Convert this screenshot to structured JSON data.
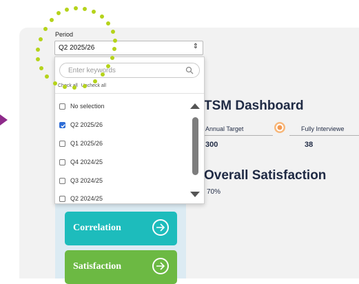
{
  "filter": {
    "label": "Period",
    "selected": "Q2 2025/26",
    "search_placeholder": "Enter keywords",
    "check_all": "Check all",
    "uncheck_all": "Uncheck all",
    "options": [
      {
        "label": "No selection",
        "checked": false
      },
      {
        "label": "Q2 2025/26",
        "checked": true
      },
      {
        "label": "Q1 2025/26",
        "checked": false
      },
      {
        "label": "Q4 2024/25",
        "checked": false
      },
      {
        "label": "Q3 2024/25",
        "checked": false
      },
      {
        "label": "Q2 2024/25",
        "checked": false
      }
    ]
  },
  "dashboard": {
    "title": "TSM Dashboard",
    "kpis": [
      {
        "label": "Annual Target",
        "value": "300"
      },
      {
        "label": "Fully Interviewe",
        "value": "38"
      }
    ],
    "section_title": "Overall Satisfaction",
    "satisfaction_value": "70%"
  },
  "nav": {
    "correlation": "Correlation",
    "satisfaction": "Satisfaction"
  },
  "colors": {
    "correlation": "#1dbcbc",
    "satisfaction": "#6cb943",
    "highlight_dots": "#b5d31b",
    "pointer": "#8e2a8a"
  }
}
